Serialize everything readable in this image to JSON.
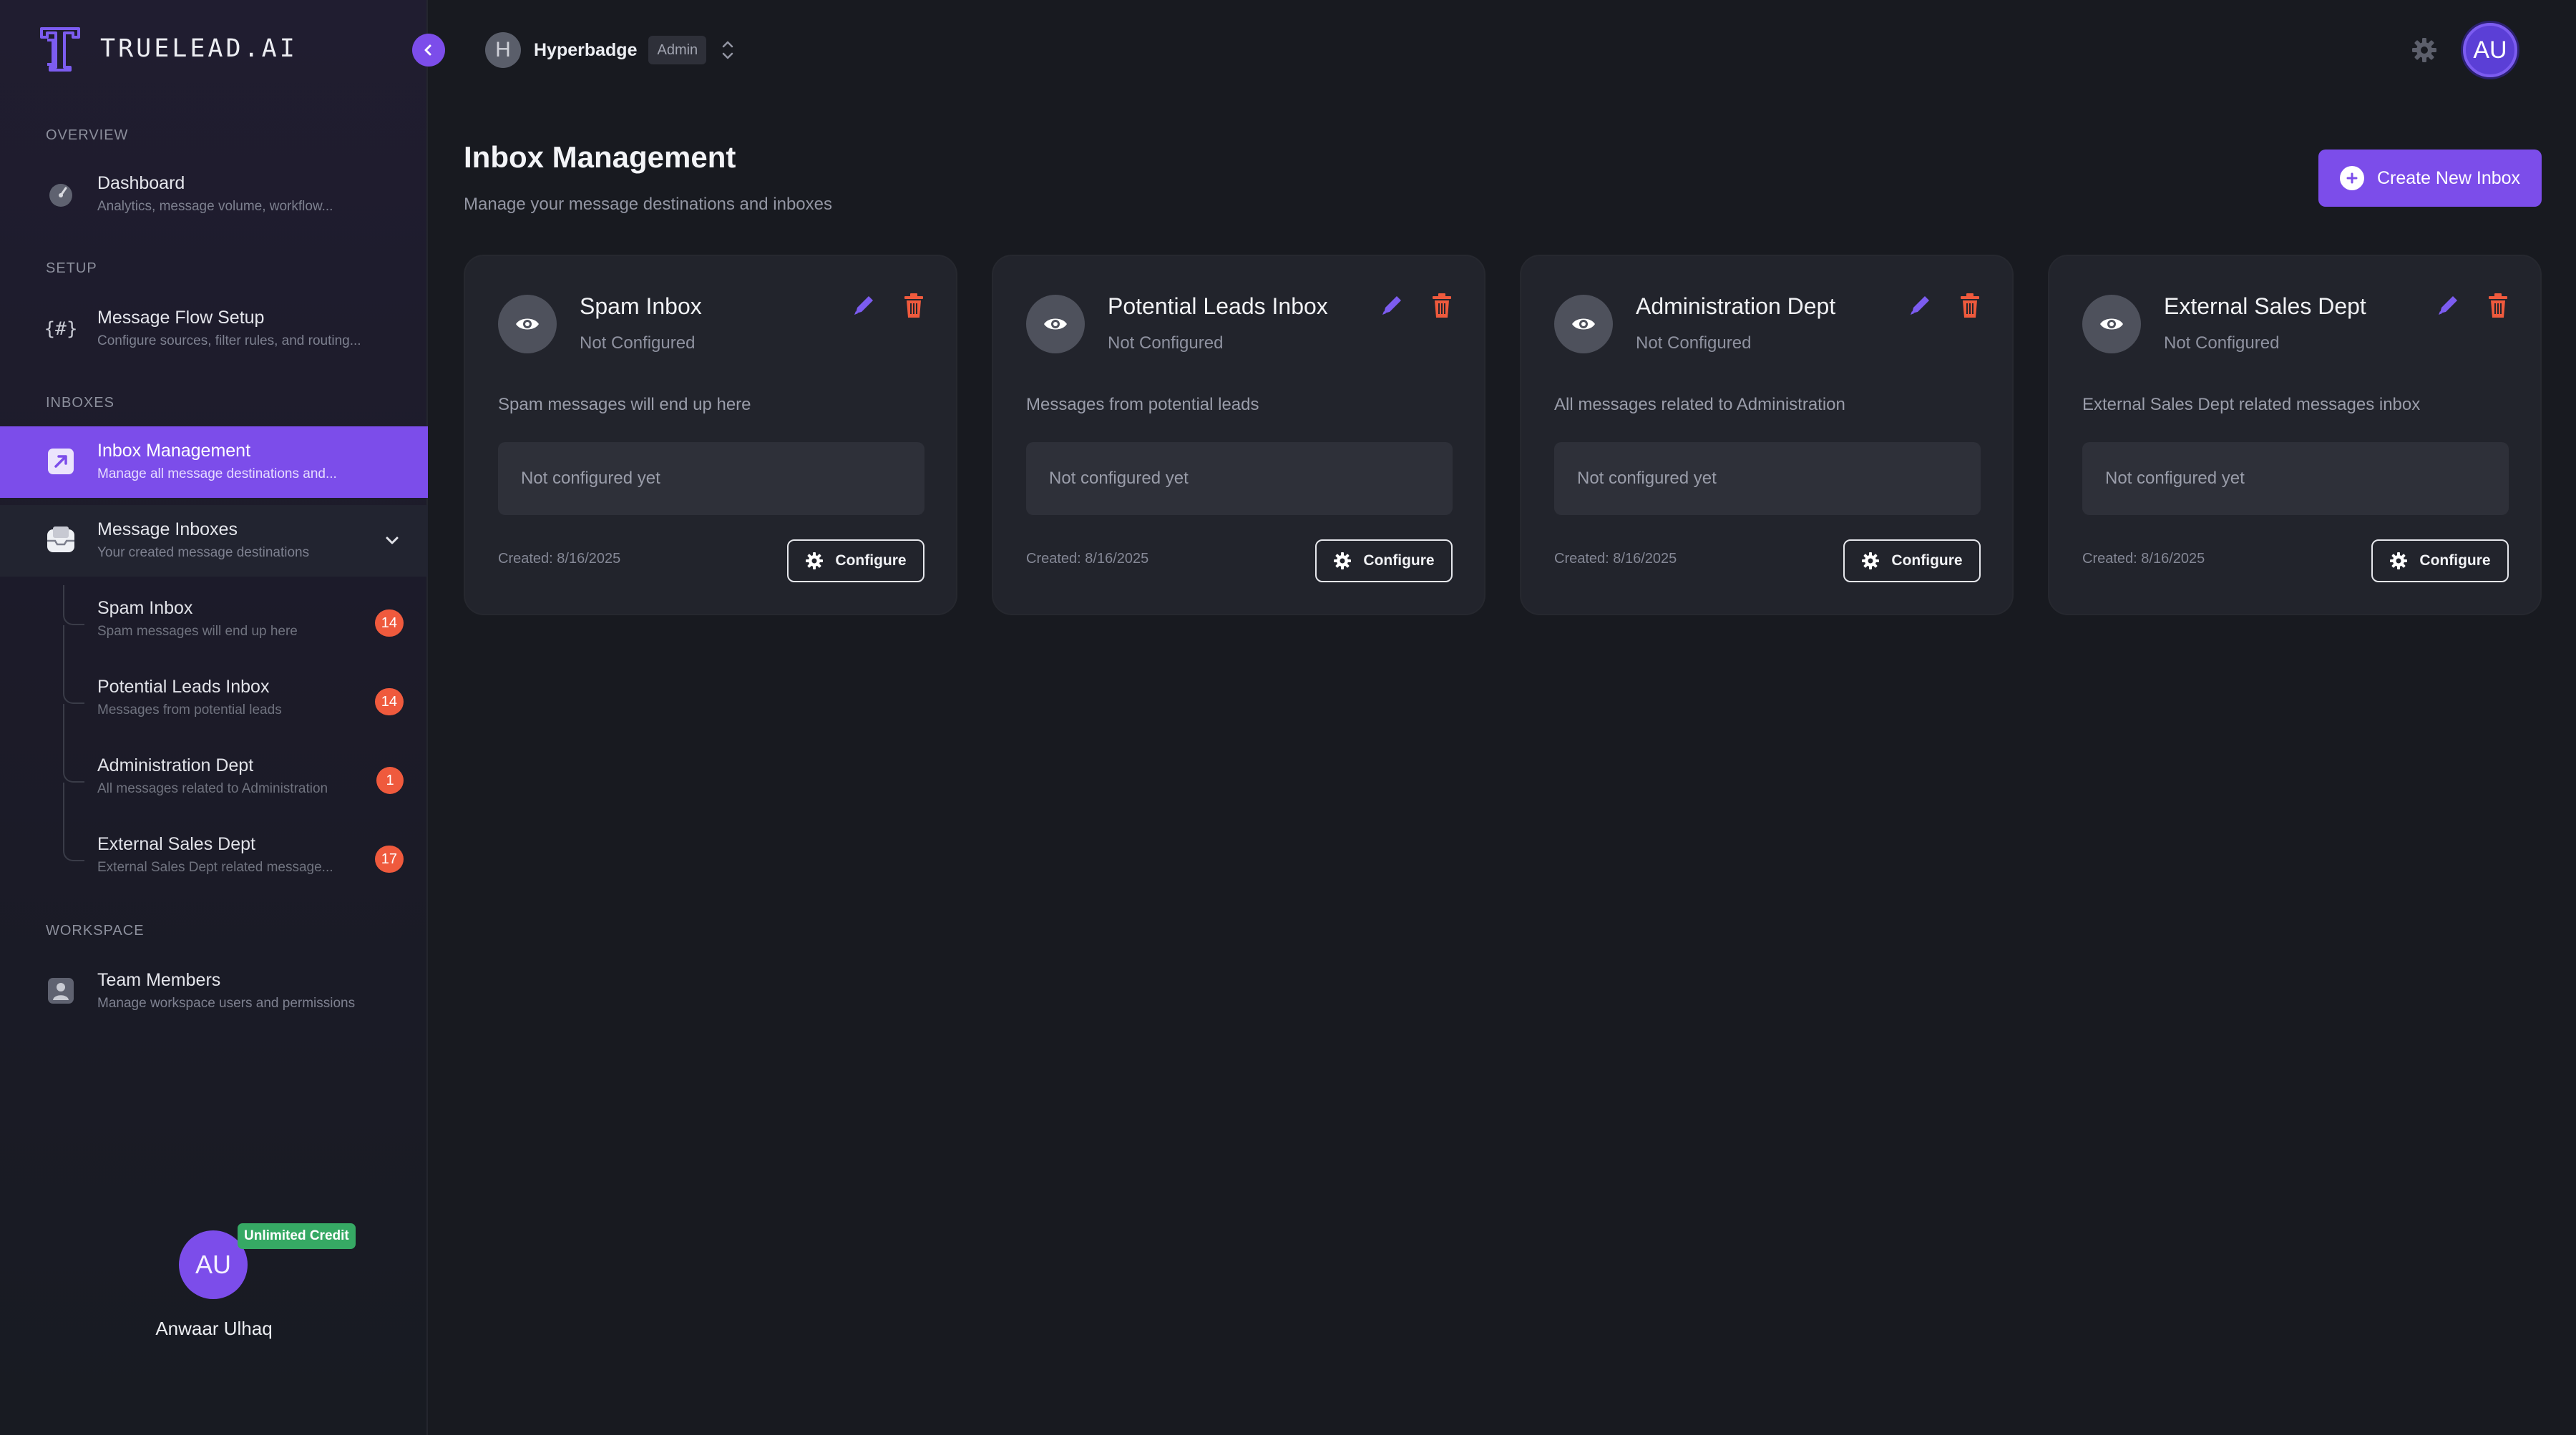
{
  "brand": {
    "name": "TRUELEAD.AI"
  },
  "workspace": {
    "initial": "H",
    "name": "Hyperbadge",
    "role": "Admin"
  },
  "topbar": {
    "avatar_initials": "AU"
  },
  "sidebar": {
    "sections": {
      "overview": "OVERVIEW",
      "setup": "SETUP",
      "inboxes": "INBOXES",
      "workspace": "WORKSPACE"
    },
    "items": [
      {
        "title": "Dashboard",
        "subtitle": "Analytics, message volume, workflow..."
      },
      {
        "title": "Message Flow Setup",
        "subtitle": "Configure sources, filter rules, and routing..."
      },
      {
        "title": "Inbox Management",
        "subtitle": "Manage all message destinations and..."
      },
      {
        "title": "Message Inboxes",
        "subtitle": "Your created message destinations"
      },
      {
        "title": "Team Members",
        "subtitle": "Manage workspace users and permissions"
      }
    ],
    "inboxes": [
      {
        "title": "Spam Inbox",
        "subtitle": "Spam messages will end up here",
        "count": "14"
      },
      {
        "title": "Potential Leads Inbox",
        "subtitle": "Messages from potential leads",
        "count": "14"
      },
      {
        "title": "Administration Dept",
        "subtitle": "All messages related to Administration",
        "count": "1"
      },
      {
        "title": "External Sales Dept",
        "subtitle": "External Sales Dept related message...",
        "count": "17"
      }
    ],
    "user": {
      "initials": "AU",
      "credit": "Unlimited Credit",
      "name": "Anwaar Ulhaq"
    }
  },
  "main": {
    "title": "Inbox Management",
    "subtitle": "Manage your message destinations and inboxes",
    "create_label": "Create New Inbox",
    "cards": [
      {
        "title": "Spam Inbox",
        "status": "Not Configured",
        "description": "Spam messages will end up here",
        "box": "Not configured yet",
        "created": "Created: 8/16/2025",
        "button": "Configure"
      },
      {
        "title": "Potential Leads Inbox",
        "status": "Not Configured",
        "description": "Messages from potential leads",
        "box": "Not configured yet",
        "created": "Created: 8/16/2025",
        "button": "Configure"
      },
      {
        "title": "Administration Dept",
        "status": "Not Configured",
        "description": "All messages related to Administration",
        "box": "Not configured yet",
        "created": "Created: 8/16/2025",
        "button": "Configure"
      },
      {
        "title": "External Sales Dept",
        "status": "Not Configured",
        "description": "External Sales Dept related messages inbox",
        "box": "Not configured yet",
        "created": "Created: 8/16/2025",
        "button": "Configure"
      }
    ]
  },
  "colors": {
    "background": "#181a20",
    "accent": "#7c4dea",
    "danger": "#ef5a3d",
    "success": "#36a964",
    "card": "#22242c"
  }
}
